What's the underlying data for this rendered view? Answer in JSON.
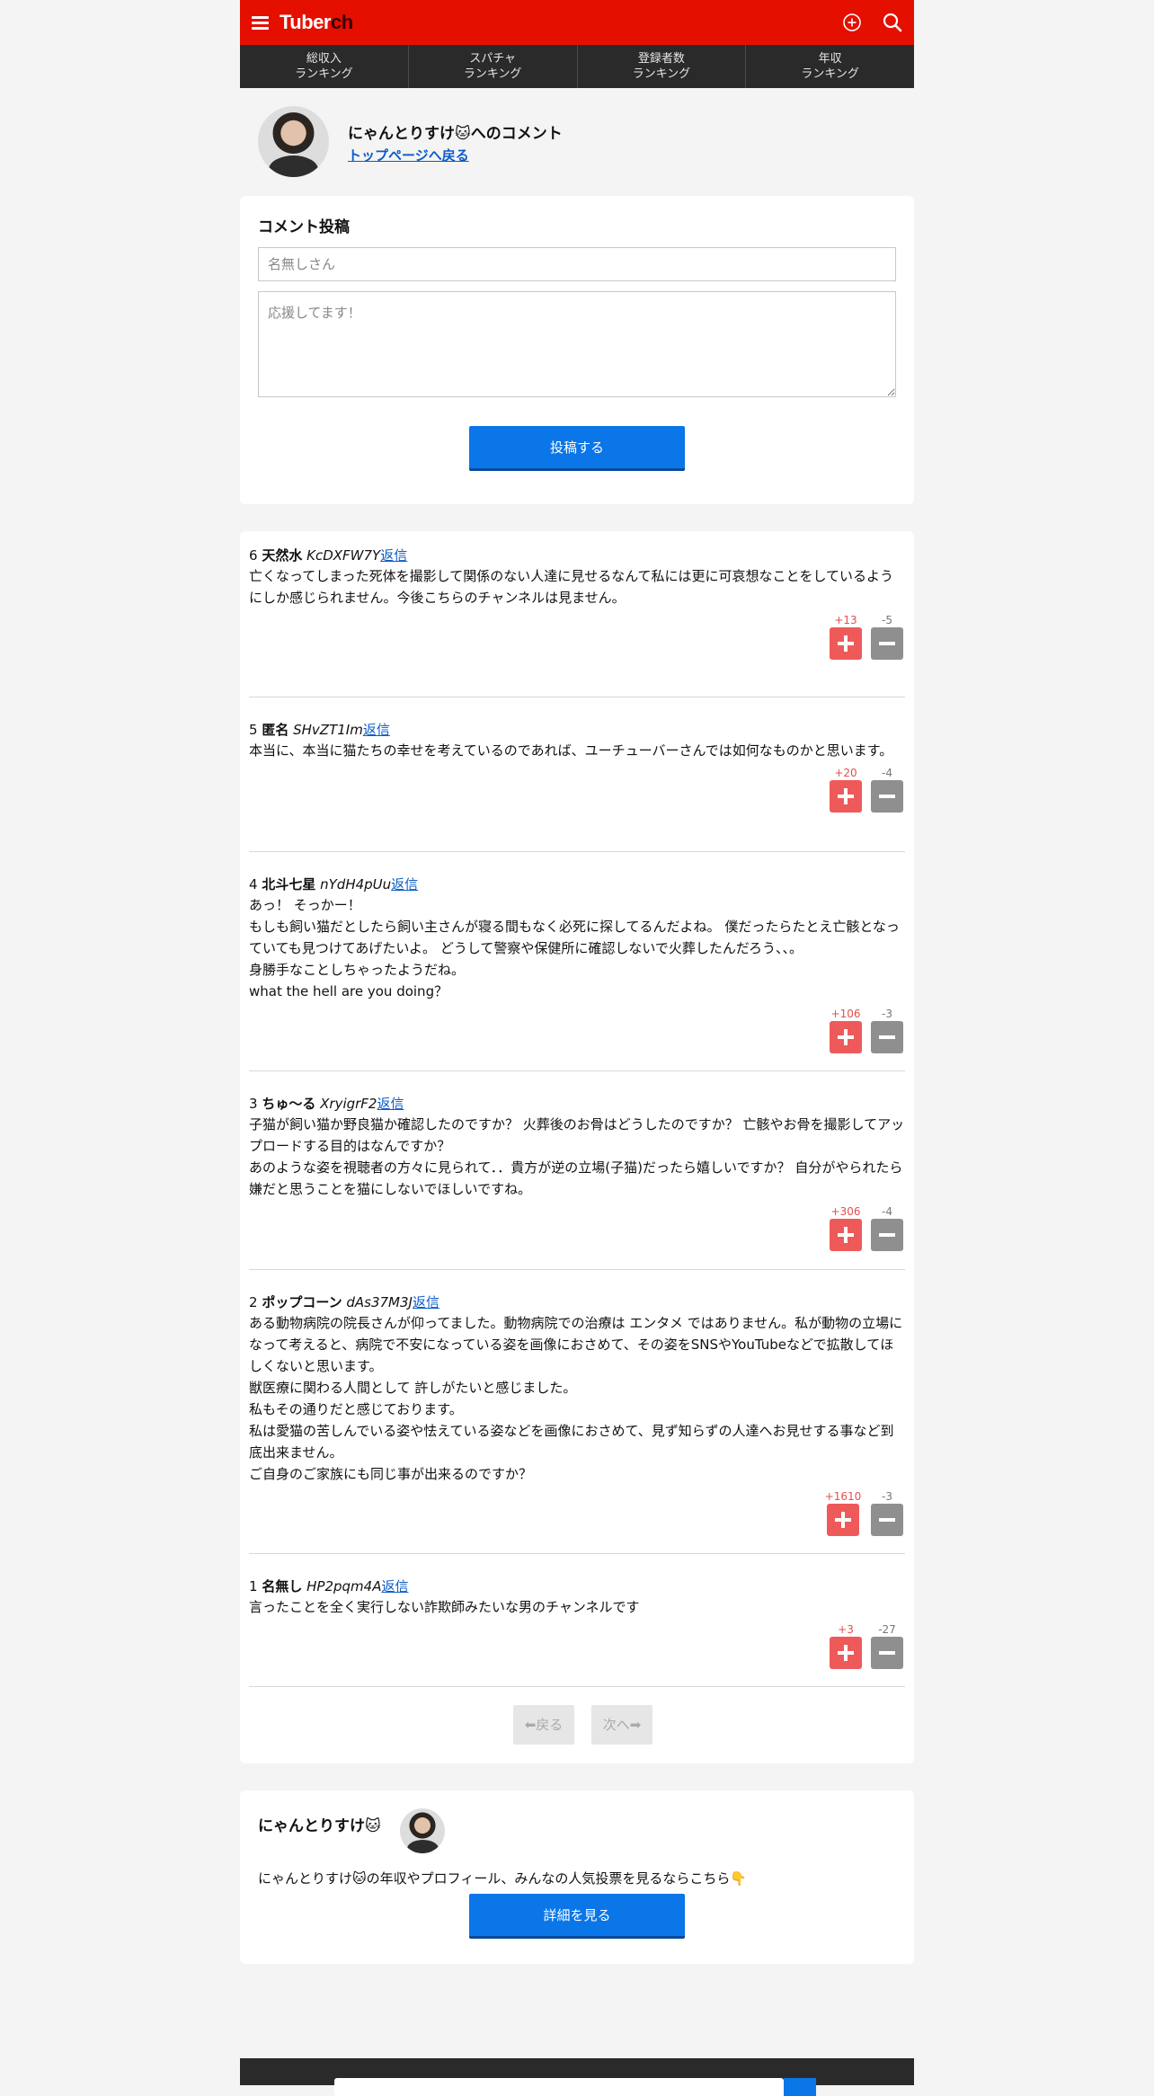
{
  "header": {
    "logo_main": "Tuber",
    "logo_accent": "ch"
  },
  "nav": [
    {
      "label": "総収入\nランキング"
    },
    {
      "label": "スパチャ\nランキング"
    },
    {
      "label": "登録者数\nランキング"
    },
    {
      "label": "年収\nランキング"
    }
  ],
  "profile": {
    "title": "にゃんとりすけ🐱へのコメント",
    "back_link": "トップページへ戻る"
  },
  "post_form": {
    "title": "コメント投稿",
    "name_placeholder": "名無しさん",
    "message_placeholder": "応援してます！",
    "submit_label": "投稿する"
  },
  "comments": [
    {
      "num": "6",
      "name": "天然水",
      "id": "KcDXFW7Y",
      "reply": "返信",
      "body": "亡くなってしまった死体を撮影して関係のない人達に見せるなんて私には更に可哀想なことをしているようにしか感じられません。今後こちらのチャンネルは見ません。",
      "up": "+13",
      "down": "-5"
    },
    {
      "num": "5",
      "name": "匿名",
      "id": "SHvZT1Im",
      "reply": "返信",
      "body": "本当に、本当に猫たちの幸せを考えているのであれば、ユーチューバーさんでは如何なものかと思います。",
      "up": "+20",
      "down": "-4"
    },
    {
      "num": "4",
      "name": "北斗七星",
      "id": "nYdH4pUu",
      "reply": "返信",
      "body": "あっ！ そっかー！\nもしも飼い猫だとしたら飼い主さんが寝る間もなく必死に探してるんだよね。 僕だったらたとえ亡骸となっていても見つけてあげたいよ。 どうして警察や保健所に確認しないで火葬したんだろう、、。\n身勝手なことしちゃったようだね。\nwhat the hell are you doing？",
      "up": "+106",
      "down": "-3"
    },
    {
      "num": "3",
      "name": "ちゅ〜る",
      "id": "XryigrF2",
      "reply": "返信",
      "body": "子猫が飼い猫か野良猫か確認したのですか？ 火葬後のお骨はどうしたのですか？ 亡骸やお骨を撮影してアップロードする目的はなんですか？\nあのような姿を視聴者の方々に見られて．．貴方が逆の立場(子猫)だったら嬉しいですか？ 自分がやられたら嫌だと思うことを猫にしないでほしいですね。",
      "up": "+306",
      "down": "-4"
    },
    {
      "num": "2",
      "name": "ポップコーン",
      "id": "dAs37M3J",
      "reply": "返信",
      "body": "ある動物病院の院長さんが仰ってました。動物病院での治療は エンタメ ではありません。私が動物の立場になって考えると、病院で不安になっている姿を画像におさめて、その姿をSNSやYouTubeなどで拡散してほしくないと思います。\n獣医療に関わる人間として 許しがたいと感じました。\n私もその通りだと感じております。\n私は愛猫の苦しんでいる姿や怯えている姿などを画像におさめて、見ず知らずの人達へお見せする事など到底出来ません。\nご自身のご家族にも同じ事が出来るのですか？",
      "up": "+1610",
      "down": "-3"
    },
    {
      "num": "1",
      "name": "名無し",
      "id": "HP2pqm4A",
      "reply": "返信",
      "body": "言ったことを全く実行しない詐欺師みたいな男のチャンネルです",
      "up": "+3",
      "down": "-27"
    }
  ],
  "pager": {
    "prev": "⬅戻る",
    "next": "次へ➡"
  },
  "channel": {
    "name": "にゃんとりすけ🐱",
    "desc": "にゃんとりすけ🐱の年収やプロフィール、みんなの人気投票を見るならこちら👇",
    "button": "詳細を見る"
  },
  "colors": {
    "brand_red": "#e50f00",
    "accent_blue": "#0a76e8",
    "upvote": "#ee5a5a",
    "downvote": "#8f8f8f"
  }
}
